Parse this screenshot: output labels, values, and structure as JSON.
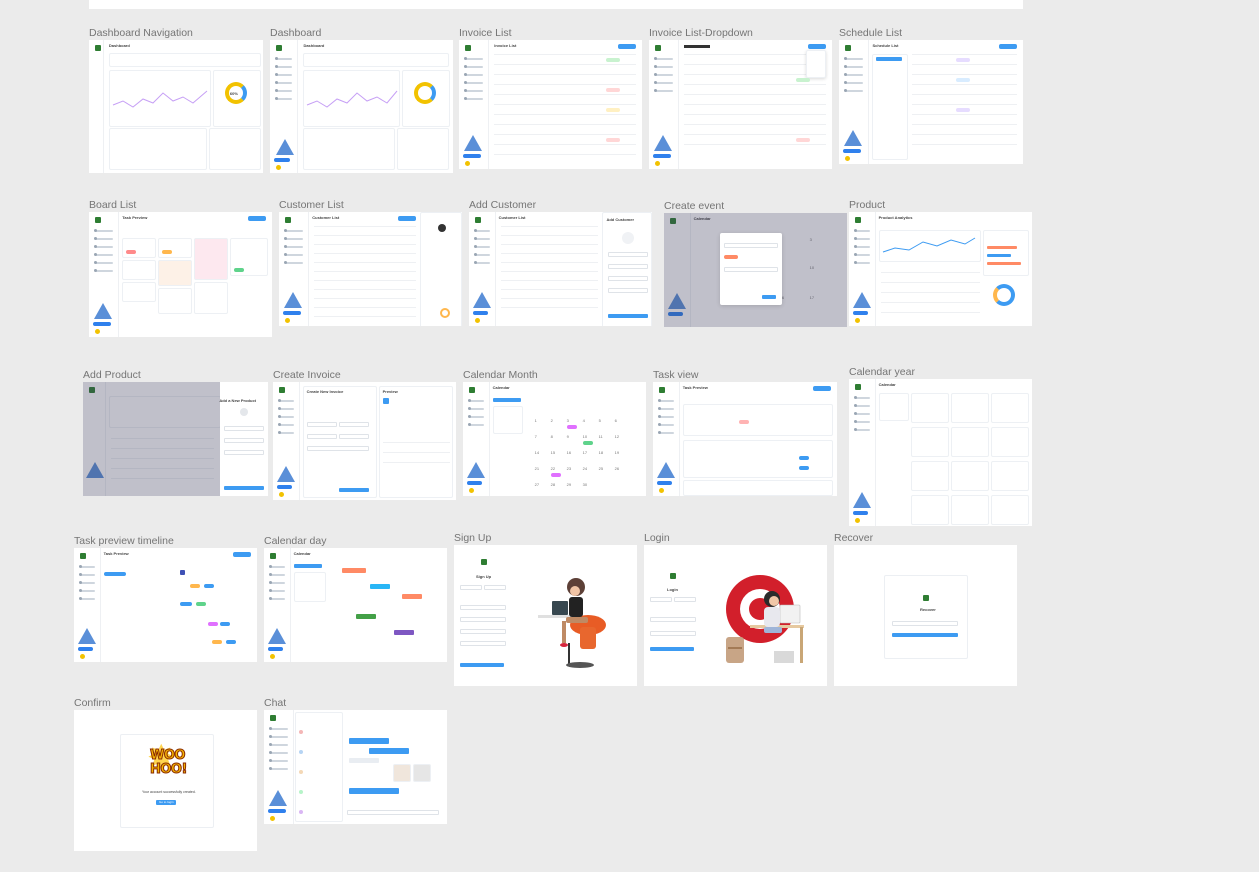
{
  "canvas": {
    "background": "#ebebeb",
    "accent": "#3d9bf2"
  },
  "frames": {
    "dashboard_navigation": "Dashboard  Navigation",
    "dashboard": "Dashboard",
    "invoice_list": "Invoice List",
    "invoice_list_dropdown": "Invoice List-Dropdown",
    "schedule_list": "Schedule List",
    "board_list": "Board List",
    "customer_list": "Customer List",
    "add_customer": "Add Customer",
    "create_event": "Create event",
    "product": "Product",
    "add_product": "Add Product",
    "create_invoice": "Create Invoice",
    "calendar_month": "Calendar Month",
    "task_view": "Task view",
    "calendar_year": "Calendar year",
    "task_preview_timeline": "Task preview timeline",
    "calendar_day": "Calendar day",
    "sign_up": "Sign Up",
    "login": "Login",
    "recover": "Recover",
    "confirm": "Confirm",
    "chat": "Chat"
  },
  "thumb_text": {
    "dashboard": "Dashboard",
    "invoice_list": "Invoice List",
    "schedule_list": "Schedule List",
    "task_preview": "Task Preview",
    "customer_list": "Customer List",
    "add_customer": "Add Customer",
    "calendar": "Calendar",
    "product_analytics": "Product Analytics",
    "add_product": "Add a New Product",
    "create_invoice": "Create New Invoice",
    "preview": "Preview",
    "sign_up": "Sign Up",
    "login": "Login",
    "recover": "Recover",
    "confirm_message": "Your account successfully created.",
    "confirm_button": "Go to login",
    "woo": "WOO",
    "hoo": "HOO!",
    "donut_value": "60%"
  }
}
